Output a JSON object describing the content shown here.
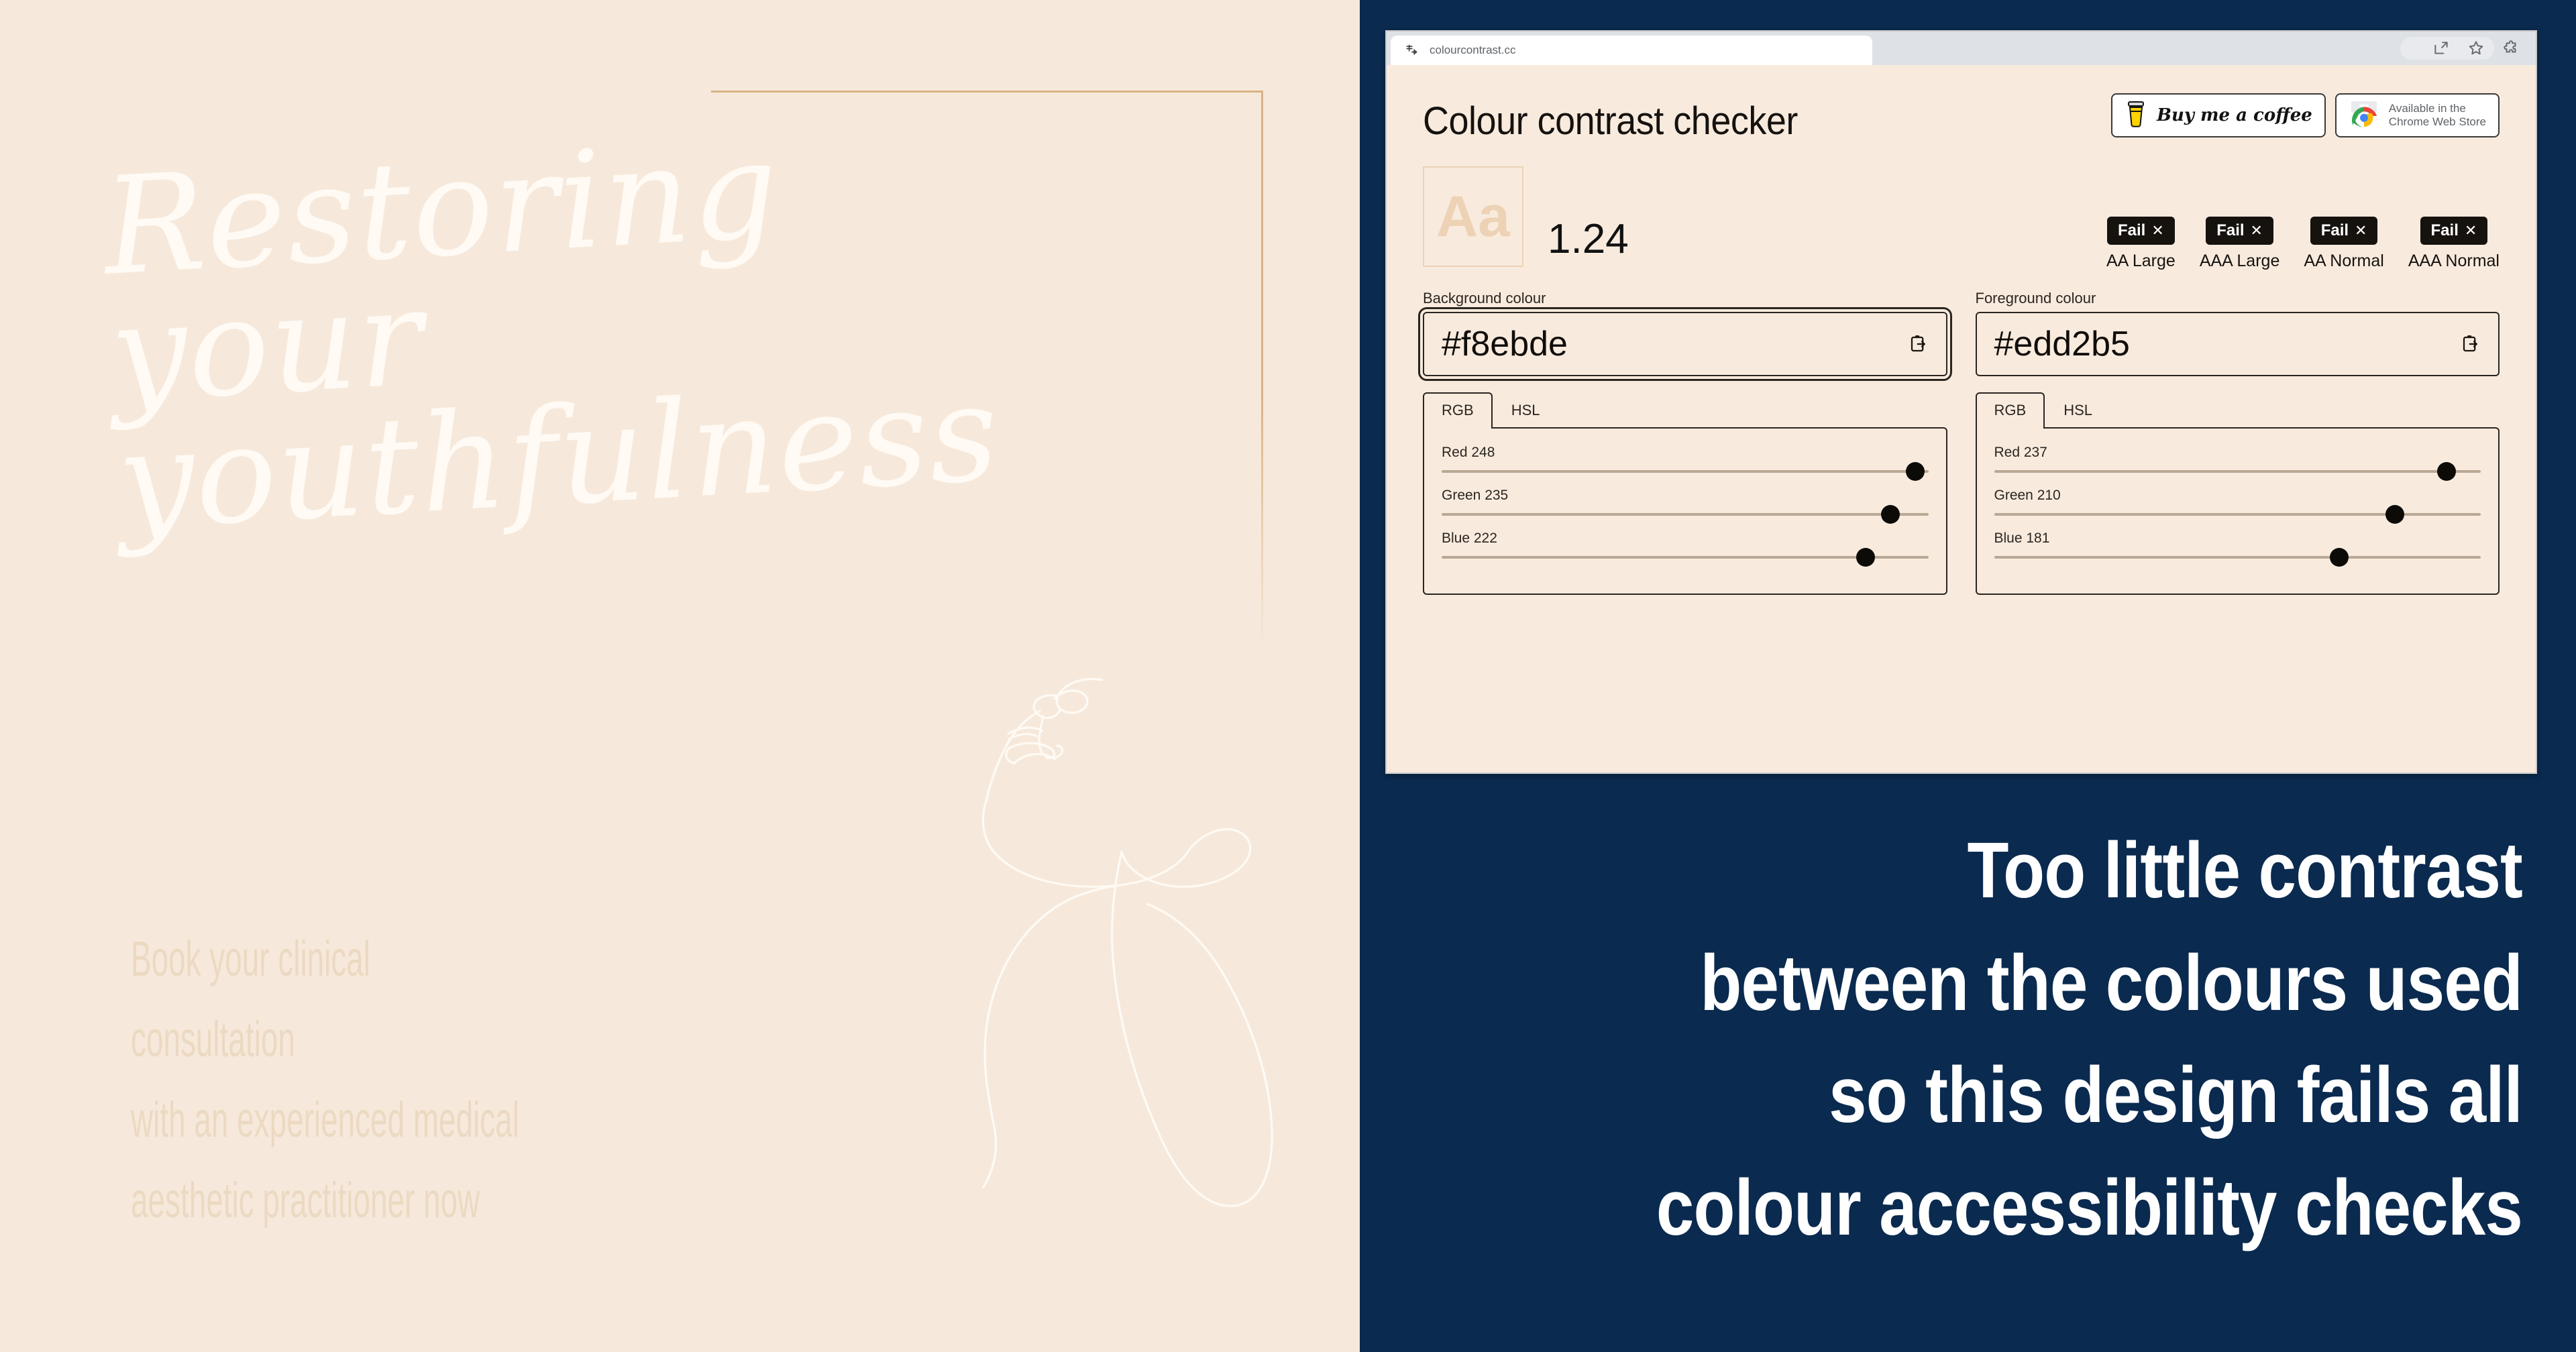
{
  "design": {
    "headline": "Restoring your\nyouthfulness",
    "body": "Book your clinical consultation\nwith an experienced medical\naesthetic practitioner now",
    "bg_colour": "#f6e9db",
    "headline_colour": "#fffaf4",
    "body_colour": "#ecd9c2",
    "frame_colour": "#d8b384"
  },
  "caption": {
    "text": "Too little contrast\nbetween the colours used\nso this design fails all\ncolour accessibility checks",
    "bg_colour": "#0a2a4f",
    "text_colour": "#ffffff"
  },
  "browser": {
    "tab_title": "colourcontrast.cc",
    "actions": [
      "share-icon",
      "bookmark-star-icon",
      "extensions-puzzle-icon"
    ]
  },
  "app": {
    "title": "Colour contrast checker",
    "buy_coffee_label": "Buy me a coffee",
    "chrome_store_label": "Available in the\nChrome Web Store",
    "preview_sample": "Aa",
    "contrast_ratio": "1.24",
    "badges": [
      {
        "result": "Fail",
        "mark": "✕",
        "label": "AA Large"
      },
      {
        "result": "Fail",
        "mark": "✕",
        "label": "AAA Large"
      },
      {
        "result": "Fail",
        "mark": "✕",
        "label": "AA Normal"
      },
      {
        "result": "Fail",
        "mark": "✕",
        "label": "AAA Normal"
      }
    ],
    "background": {
      "field_label": "Background colour",
      "hex": "#f8ebde",
      "tabs": [
        "RGB",
        "HSL"
      ],
      "active_tab": "RGB",
      "sliders": [
        {
          "label": "Red 248",
          "channel": "Red",
          "value": 248,
          "max": 255
        },
        {
          "label": "Green 235",
          "channel": "Green",
          "value": 235,
          "max": 255
        },
        {
          "label": "Blue 222",
          "channel": "Blue",
          "value": 222,
          "max": 255
        }
      ]
    },
    "foreground": {
      "field_label": "Foreground colour",
      "hex": "#edd2b5",
      "tabs": [
        "RGB",
        "HSL"
      ],
      "active_tab": "RGB",
      "sliders": [
        {
          "label": "Red 237",
          "channel": "Red",
          "value": 237,
          "max": 255
        },
        {
          "label": "Green 210",
          "channel": "Green",
          "value": 210,
          "max": 255
        },
        {
          "label": "Blue 181",
          "channel": "Blue",
          "value": 181,
          "max": 255
        }
      ]
    }
  }
}
